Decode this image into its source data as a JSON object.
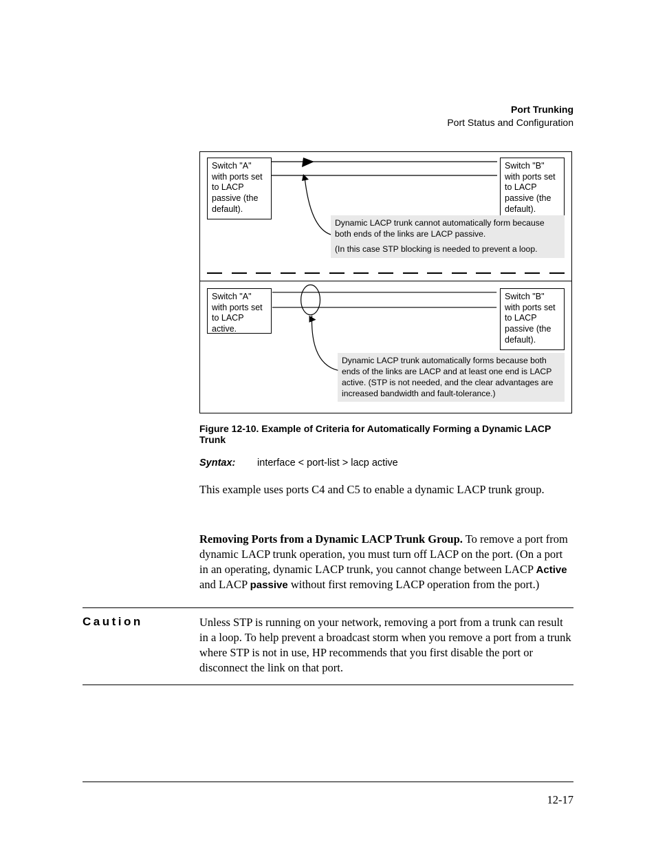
{
  "header": {
    "title": "Port Trunking",
    "subtitle": "Port Status and Configuration"
  },
  "diagram": {
    "top": {
      "left_label": "Switch \"A\" with ports set to LACP passive (the default).",
      "right_label": "Switch \"B\" with ports set to LACP passive (the default).",
      "callout_line1": "Dynamic LACP trunk cannot automatically form because both ends of the links are LACP passive.",
      "callout_line2": "(In this case STP blocking is needed to prevent a loop."
    },
    "bottom": {
      "left_label": "Switch \"A\" with ports set to LACP active.",
      "right_label": "Switch \"B\" with ports set to LACP passive (the default).",
      "callout": "Dynamic LACP trunk automatically forms because both ends of the links are LACP and at least one end is LACP active. (STP is not needed, and the clear advantages are increased bandwidth and fault-tolerance.)"
    }
  },
  "figcaption": "Figure 12-10.  Example of Criteria for Automatically Forming a Dynamic LACP Trunk",
  "syntax": {
    "label": "Syntax:",
    "text": "interface < port-list > lacp active"
  },
  "para_example": "This example uses ports C4 and C5 to enable a dynamic LACP trunk group.",
  "para_remove": {
    "runin": "Removing Ports from a Dynamic LACP Trunk Group.",
    "seg1": "  To remove a port from dynamic LACP trunk operation, you must turn off LACP on the port. (On a port in an operating, dynamic LACP trunk, you cannot change between LACP ",
    "active": "Active",
    "seg2": " and LACP ",
    "passive": "passive",
    "seg3": " without first removing LACP operation from the port.)"
  },
  "caution": {
    "label": "Caution",
    "text": "Unless STP is running on your network, removing a port from a trunk can result in a loop. To help prevent a broadcast storm when you remove a port from a trunk where STP is not in use, HP recommends that you first disable the port or disconnect the link on that port."
  },
  "pagenum": "12-17"
}
